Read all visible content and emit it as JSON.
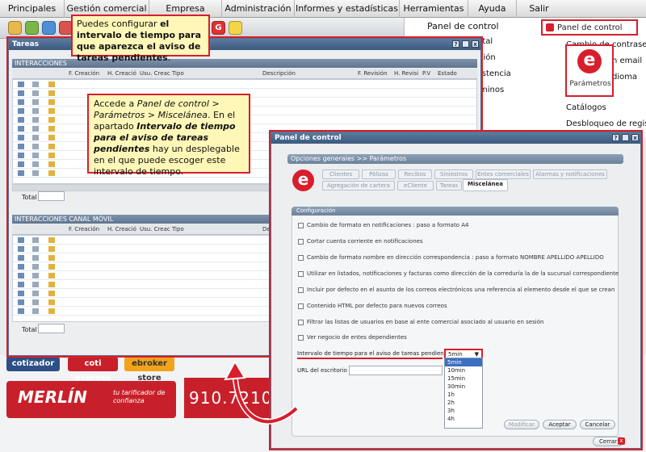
{
  "menu": [
    "Principales",
    "Gestión comercial",
    "Empresa",
    "Administración",
    "Informes y estadísticas",
    "Herramientas",
    "Ayuda",
    "Salir"
  ],
  "toolbar_icons": [
    "folder-icon",
    "contacts-icon",
    "calendar-icon",
    "document-icon",
    "image-icon",
    "chart-icon",
    "phone-icon",
    "globe-icon",
    "star-icon",
    "home-icon",
    "mail-icon",
    "gear-icon",
    "g-icon",
    "bulb-icon"
  ],
  "dropdown_menu": {
    "panel_control": "Panel de control",
    "panel_control_active": "Panel de control",
    "item_1": "Cambio de contraseña",
    "item_2": "ntal",
    "item_3": "n email",
    "item_4": "ción",
    "item_5": "dioma",
    "item_6": "istencia",
    "item_7": "minos",
    "catalogos": "Catálogos",
    "desbloqueo": "Desbloqueo de registros",
    "parametros_label": "Parámetros"
  },
  "tareas_window": {
    "title": "Tareas",
    "section1": "INTERACCIONES",
    "section2": "INTERACCIONES CANAL MÓVIL",
    "cols1": [
      "F. Creación",
      "H. Creació",
      "Usu. Creac",
      "Tipo",
      "Descripción",
      "F. Revisión",
      "H. Revisi",
      "P.V",
      "Estado"
    ],
    "cols2": [
      "F. Creación",
      "H. Creació",
      "Usu. Creac",
      "Tipo",
      "Des"
    ],
    "total_label": "Total",
    "total_label2": "Total"
  },
  "callout_top": {
    "part1": "Puedes configurar ",
    "bold1": "el intervalo de tiempo para que aparezca el aviso de tareas pendientes",
    "part2": "."
  },
  "callout_mid": {
    "t1": "Accede a ",
    "i1": "Panel de control > Parámetros > Miscelánea",
    "t2": ". En el apartado ",
    "bi1": "Intervalo de tiempo para el aviso de tareas pendientes",
    "t3": " hay un desplegable en el que puede escoger este intervalo de tiempo."
  },
  "panel_control": {
    "title": "Panel de control",
    "breadcrumb": "Opciones generales >> Parámetros",
    "tabs_row1": [
      "Clientes",
      "Pólizas",
      "Recibos",
      "Siniestros",
      "Entes comerciales",
      "Alarmas y notificaciones"
    ],
    "tabs_row2": [
      "Agregación de cartera",
      "eCliente",
      "Tareas",
      "Miscelánea"
    ],
    "config_header": "Configuración",
    "options": [
      "Cambio de formato en notificaciones : paso a formato A4",
      "Cortar cuenta corriente en notificaciones",
      "Cambio de formato nombre en dirección correspondencia : paso a formato NOMBRE APELLIDO APELLIDO",
      "Utilizar en listados, notificaciones y facturas como dirección de la correduría la de la sucursal correspondiente",
      "Incluir por defecto en el asunto de los correos electrónicos una referencia al elemento desde el que se crean",
      "Contenido HTML por defecto para nuevos correos",
      "Filtrar las listas de usuarios en base al ente comercial asociado al usuario en sesión",
      "Ver negocio de entes dependientes"
    ],
    "interval_label": "Intervalo de tiempo para el aviso de tareas pendientes",
    "interval_value": "5min",
    "url_label": "URL del escritorio",
    "dropdown_options": [
      "5min",
      "10min",
      "15min",
      "30min",
      "1h",
      "2h",
      "3h",
      "4h"
    ],
    "btn_modificar": "Modificar",
    "btn_aceptar": "Aceptar",
    "btn_cancelar": "Cancelar",
    "btn_cerrar": "Cerrar"
  },
  "background": {
    "btn_cotizador": "cotizador",
    "btn_coti_express": "coti express",
    "btn_ebroker": "ebroker store",
    "merlin_brand": "MERLÍN",
    "merlin_tagline": "tu tarificador de confianza",
    "phone": "910.7210"
  },
  "colors": {
    "accent_red": "#d81e2c",
    "window_title": "#3c5a80",
    "callout_bg": "#fff7b8"
  }
}
